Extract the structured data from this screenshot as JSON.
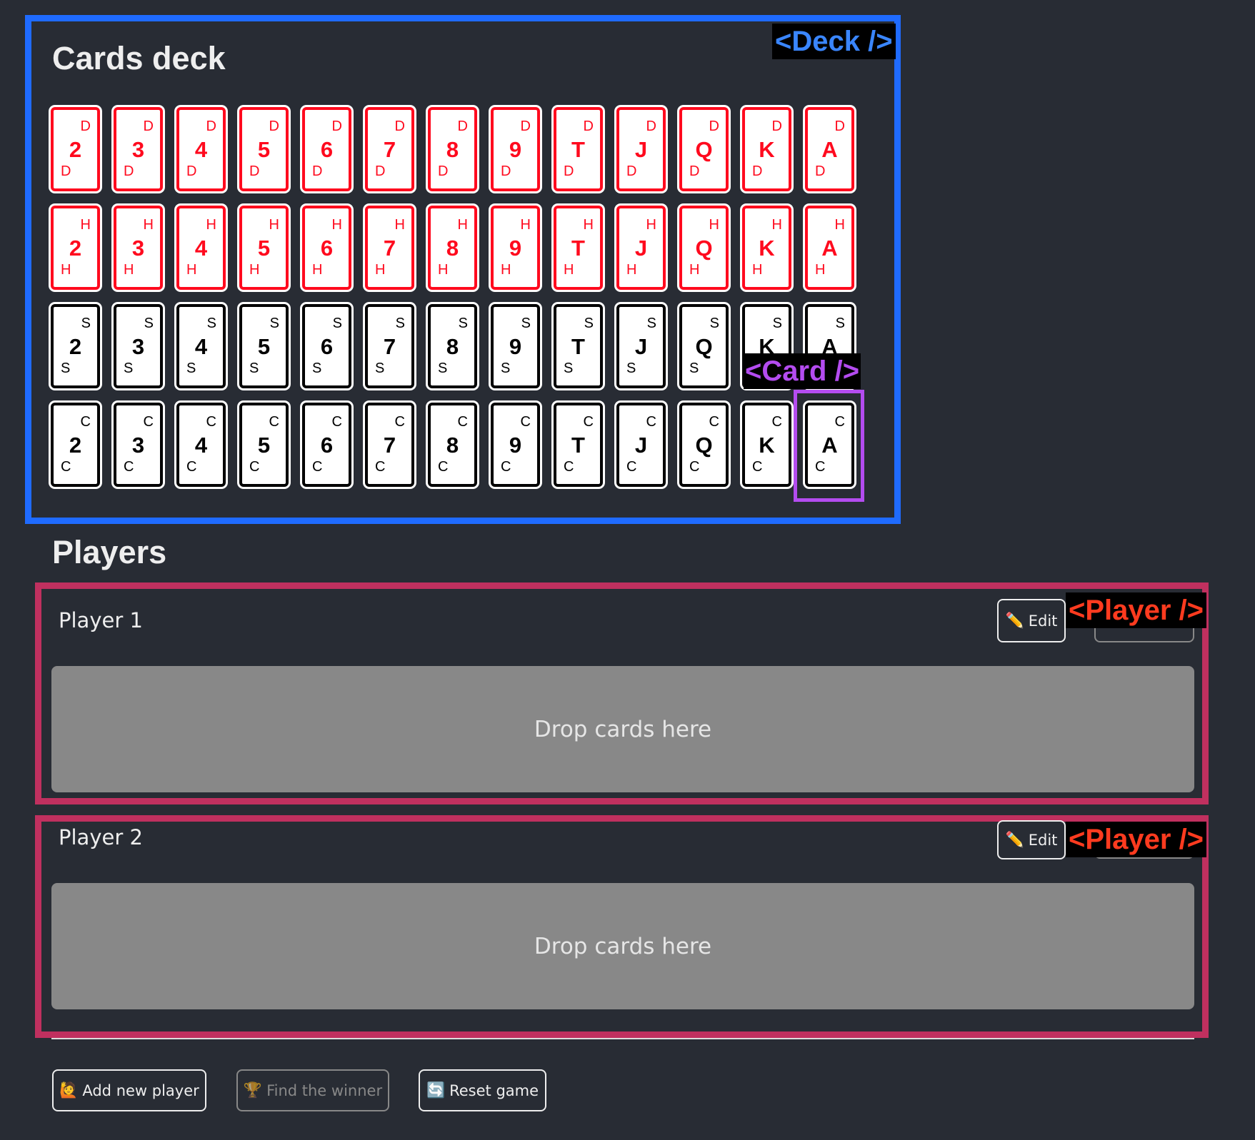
{
  "deck": {
    "title": "Cards deck",
    "tag": "<Deck />",
    "suits": [
      {
        "code": "D",
        "color": "#ff0a1e"
      },
      {
        "code": "H",
        "color": "#ff0a1e"
      },
      {
        "code": "S",
        "color": "#000000"
      },
      {
        "code": "C",
        "color": "#000000"
      }
    ],
    "ranks": [
      "2",
      "3",
      "4",
      "5",
      "6",
      "7",
      "8",
      "9",
      "T",
      "J",
      "Q",
      "K",
      "A"
    ],
    "card_tag": "<Card />"
  },
  "players": {
    "title": "Players",
    "tag": "<Player />",
    "list": [
      {
        "name": "Player 1",
        "edit_label": "Edit",
        "edit_icon": "✏️",
        "drop_label": "Drop cards here"
      },
      {
        "name": "Player 2",
        "edit_label": "Edit",
        "edit_icon": "✏️",
        "drop_label": "Drop cards here"
      }
    ]
  },
  "actions": {
    "add_player": {
      "label": "Add new player",
      "icon": "🙋"
    },
    "find_winner": {
      "label": "Find the winner",
      "icon": "🏆",
      "disabled": true
    },
    "reset": {
      "label": "Reset game",
      "icon": "🔄"
    }
  },
  "colors": {
    "deck_outline": "#1f6bff",
    "player_outline": "#c0305f",
    "card_outline": "#b44cf0",
    "deck_tag": "#3a86ff",
    "player_tag": "#ff3b1f",
    "card_tag": "#b44cf0"
  }
}
